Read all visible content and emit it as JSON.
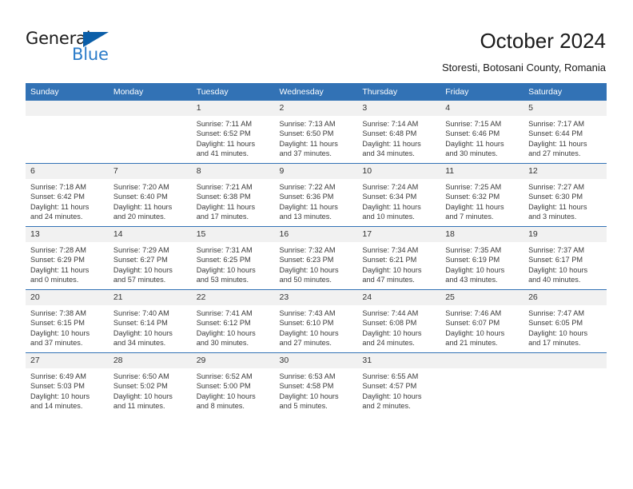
{
  "brand": {
    "name_part1": "General",
    "name_part2": "Blue",
    "triangle_icon": "triangle-icon",
    "accent_dark": "#0b5ea8",
    "accent_light": "#2b7cc9"
  },
  "header": {
    "title": "October 2024",
    "subtitle": "Storesti, Botosani County, Romania"
  },
  "theme": {
    "header_blue": "#3272b5",
    "daynum_band": "#f1f1f1",
    "text": "#333333"
  },
  "weekday_headers": [
    "Sunday",
    "Monday",
    "Tuesday",
    "Wednesday",
    "Thursday",
    "Friday",
    "Saturday"
  ],
  "weeks": [
    [
      {
        "day": "",
        "empty": true,
        "sunrise": "",
        "sunset": "",
        "daylight_l1": "",
        "daylight_l2": ""
      },
      {
        "day": "",
        "empty": true,
        "sunrise": "",
        "sunset": "",
        "daylight_l1": "",
        "daylight_l2": ""
      },
      {
        "day": "1",
        "sunrise": "Sunrise: 7:11 AM",
        "sunset": "Sunset: 6:52 PM",
        "daylight_l1": "Daylight: 11 hours",
        "daylight_l2": "and 41 minutes."
      },
      {
        "day": "2",
        "sunrise": "Sunrise: 7:13 AM",
        "sunset": "Sunset: 6:50 PM",
        "daylight_l1": "Daylight: 11 hours",
        "daylight_l2": "and 37 minutes."
      },
      {
        "day": "3",
        "sunrise": "Sunrise: 7:14 AM",
        "sunset": "Sunset: 6:48 PM",
        "daylight_l1": "Daylight: 11 hours",
        "daylight_l2": "and 34 minutes."
      },
      {
        "day": "4",
        "sunrise": "Sunrise: 7:15 AM",
        "sunset": "Sunset: 6:46 PM",
        "daylight_l1": "Daylight: 11 hours",
        "daylight_l2": "and 30 minutes."
      },
      {
        "day": "5",
        "sunrise": "Sunrise: 7:17 AM",
        "sunset": "Sunset: 6:44 PM",
        "daylight_l1": "Daylight: 11 hours",
        "daylight_l2": "and 27 minutes."
      }
    ],
    [
      {
        "day": "6",
        "sunrise": "Sunrise: 7:18 AM",
        "sunset": "Sunset: 6:42 PM",
        "daylight_l1": "Daylight: 11 hours",
        "daylight_l2": "and 24 minutes."
      },
      {
        "day": "7",
        "sunrise": "Sunrise: 7:20 AM",
        "sunset": "Sunset: 6:40 PM",
        "daylight_l1": "Daylight: 11 hours",
        "daylight_l2": "and 20 minutes."
      },
      {
        "day": "8",
        "sunrise": "Sunrise: 7:21 AM",
        "sunset": "Sunset: 6:38 PM",
        "daylight_l1": "Daylight: 11 hours",
        "daylight_l2": "and 17 minutes."
      },
      {
        "day": "9",
        "sunrise": "Sunrise: 7:22 AM",
        "sunset": "Sunset: 6:36 PM",
        "daylight_l1": "Daylight: 11 hours",
        "daylight_l2": "and 13 minutes."
      },
      {
        "day": "10",
        "sunrise": "Sunrise: 7:24 AM",
        "sunset": "Sunset: 6:34 PM",
        "daylight_l1": "Daylight: 11 hours",
        "daylight_l2": "and 10 minutes."
      },
      {
        "day": "11",
        "sunrise": "Sunrise: 7:25 AM",
        "sunset": "Sunset: 6:32 PM",
        "daylight_l1": "Daylight: 11 hours",
        "daylight_l2": "and 7 minutes."
      },
      {
        "day": "12",
        "sunrise": "Sunrise: 7:27 AM",
        "sunset": "Sunset: 6:30 PM",
        "daylight_l1": "Daylight: 11 hours",
        "daylight_l2": "and 3 minutes."
      }
    ],
    [
      {
        "day": "13",
        "sunrise": "Sunrise: 7:28 AM",
        "sunset": "Sunset: 6:29 PM",
        "daylight_l1": "Daylight: 11 hours",
        "daylight_l2": "and 0 minutes."
      },
      {
        "day": "14",
        "sunrise": "Sunrise: 7:29 AM",
        "sunset": "Sunset: 6:27 PM",
        "daylight_l1": "Daylight: 10 hours",
        "daylight_l2": "and 57 minutes."
      },
      {
        "day": "15",
        "sunrise": "Sunrise: 7:31 AM",
        "sunset": "Sunset: 6:25 PM",
        "daylight_l1": "Daylight: 10 hours",
        "daylight_l2": "and 53 minutes."
      },
      {
        "day": "16",
        "sunrise": "Sunrise: 7:32 AM",
        "sunset": "Sunset: 6:23 PM",
        "daylight_l1": "Daylight: 10 hours",
        "daylight_l2": "and 50 minutes."
      },
      {
        "day": "17",
        "sunrise": "Sunrise: 7:34 AM",
        "sunset": "Sunset: 6:21 PM",
        "daylight_l1": "Daylight: 10 hours",
        "daylight_l2": "and 47 minutes."
      },
      {
        "day": "18",
        "sunrise": "Sunrise: 7:35 AM",
        "sunset": "Sunset: 6:19 PM",
        "daylight_l1": "Daylight: 10 hours",
        "daylight_l2": "and 43 minutes."
      },
      {
        "day": "19",
        "sunrise": "Sunrise: 7:37 AM",
        "sunset": "Sunset: 6:17 PM",
        "daylight_l1": "Daylight: 10 hours",
        "daylight_l2": "and 40 minutes."
      }
    ],
    [
      {
        "day": "20",
        "sunrise": "Sunrise: 7:38 AM",
        "sunset": "Sunset: 6:15 PM",
        "daylight_l1": "Daylight: 10 hours",
        "daylight_l2": "and 37 minutes."
      },
      {
        "day": "21",
        "sunrise": "Sunrise: 7:40 AM",
        "sunset": "Sunset: 6:14 PM",
        "daylight_l1": "Daylight: 10 hours",
        "daylight_l2": "and 34 minutes."
      },
      {
        "day": "22",
        "sunrise": "Sunrise: 7:41 AM",
        "sunset": "Sunset: 6:12 PM",
        "daylight_l1": "Daylight: 10 hours",
        "daylight_l2": "and 30 minutes."
      },
      {
        "day": "23",
        "sunrise": "Sunrise: 7:43 AM",
        "sunset": "Sunset: 6:10 PM",
        "daylight_l1": "Daylight: 10 hours",
        "daylight_l2": "and 27 minutes."
      },
      {
        "day": "24",
        "sunrise": "Sunrise: 7:44 AM",
        "sunset": "Sunset: 6:08 PM",
        "daylight_l1": "Daylight: 10 hours",
        "daylight_l2": "and 24 minutes."
      },
      {
        "day": "25",
        "sunrise": "Sunrise: 7:46 AM",
        "sunset": "Sunset: 6:07 PM",
        "daylight_l1": "Daylight: 10 hours",
        "daylight_l2": "and 21 minutes."
      },
      {
        "day": "26",
        "sunrise": "Sunrise: 7:47 AM",
        "sunset": "Sunset: 6:05 PM",
        "daylight_l1": "Daylight: 10 hours",
        "daylight_l2": "and 17 minutes."
      }
    ],
    [
      {
        "day": "27",
        "sunrise": "Sunrise: 6:49 AM",
        "sunset": "Sunset: 5:03 PM",
        "daylight_l1": "Daylight: 10 hours",
        "daylight_l2": "and 14 minutes."
      },
      {
        "day": "28",
        "sunrise": "Sunrise: 6:50 AM",
        "sunset": "Sunset: 5:02 PM",
        "daylight_l1": "Daylight: 10 hours",
        "daylight_l2": "and 11 minutes."
      },
      {
        "day": "29",
        "sunrise": "Sunrise: 6:52 AM",
        "sunset": "Sunset: 5:00 PM",
        "daylight_l1": "Daylight: 10 hours",
        "daylight_l2": "and 8 minutes."
      },
      {
        "day": "30",
        "sunrise": "Sunrise: 6:53 AM",
        "sunset": "Sunset: 4:58 PM",
        "daylight_l1": "Daylight: 10 hours",
        "daylight_l2": "and 5 minutes."
      },
      {
        "day": "31",
        "sunrise": "Sunrise: 6:55 AM",
        "sunset": "Sunset: 4:57 PM",
        "daylight_l1": "Daylight: 10 hours",
        "daylight_l2": "and 2 minutes."
      },
      {
        "day": "",
        "empty": true,
        "sunrise": "",
        "sunset": "",
        "daylight_l1": "",
        "daylight_l2": ""
      },
      {
        "day": "",
        "empty": true,
        "sunrise": "",
        "sunset": "",
        "daylight_l1": "",
        "daylight_l2": ""
      }
    ]
  ]
}
